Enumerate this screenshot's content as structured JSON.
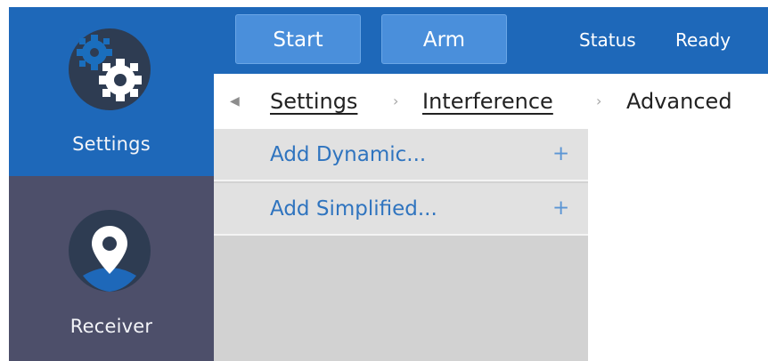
{
  "sidebar": {
    "items": [
      {
        "label": "Settings",
        "icon": "gear-icon",
        "active": true
      },
      {
        "label": "Receiver",
        "icon": "location-pin-icon",
        "active": false
      }
    ]
  },
  "toolbar": {
    "start_label": "Start",
    "arm_label": "Arm",
    "status_label": "Status",
    "status_value": "Ready"
  },
  "breadcrumb": {
    "back_icon": "back-arrow-icon",
    "items": [
      "Settings",
      "Interference",
      "Advanced"
    ]
  },
  "menu": {
    "items": [
      {
        "label": "Add Dynamic...",
        "icon": "plus-icon"
      },
      {
        "label": "Add Simplified...",
        "icon": "plus-icon"
      }
    ]
  },
  "colors": {
    "primary_blue": "#1e68b9",
    "button_blue": "#4a8fdb",
    "sidebar_dark": "#4d4f6a",
    "icon_dark": "#2e3c52",
    "link_blue": "#2f74bf"
  }
}
